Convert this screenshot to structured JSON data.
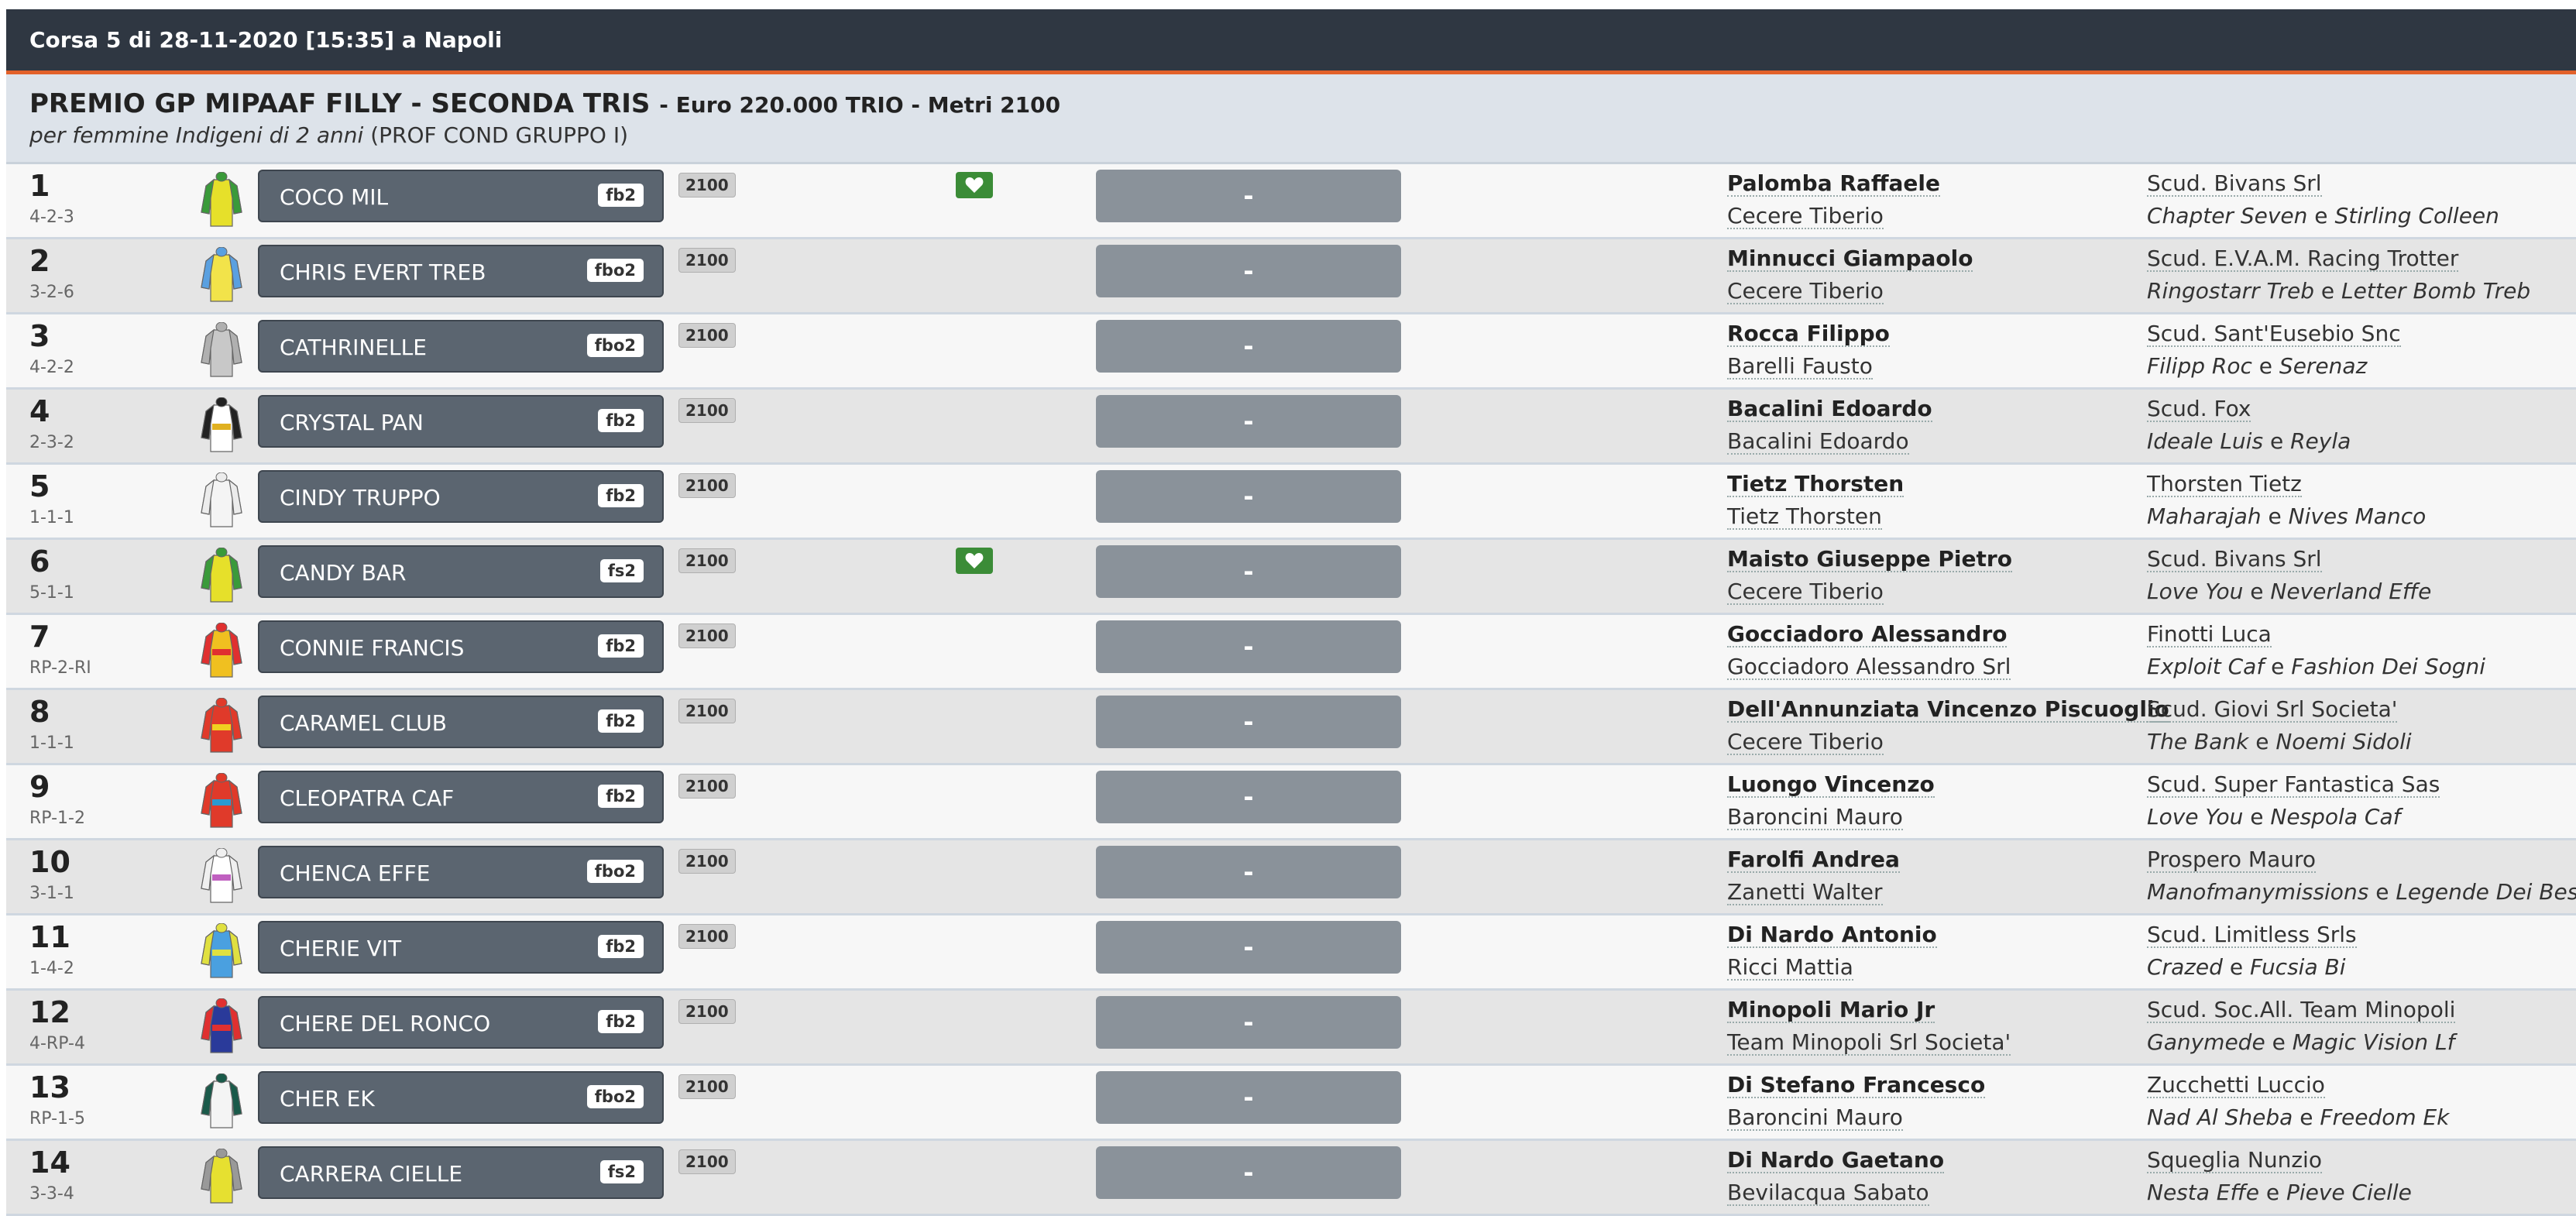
{
  "header": {
    "title": "Corsa 5 di 28-11-2020 [15:35] a Napoli"
  },
  "race": {
    "name": "PREMIO GP MIPAAF FILLY - SECONDA TRIS",
    "details": "- Euro 220.000 TRIO - Metri 2100",
    "category": "per femmine Indigeni di 2 anni",
    "conditions": "(PROF COND GRUPPO I)"
  },
  "colors": {
    "accent": "#e2612a",
    "header_bg": "#2f3742",
    "horse_bg": "#5b6570",
    "favorite": "#3b8c37"
  },
  "runners": [
    {
      "num": "1",
      "form": "4-2-3",
      "jersey": {
        "body": "#e6e02a",
        "sleeve": "#3a9a3a",
        "stripe": ""
      },
      "horse": "COCO MIL",
      "tag": "fb2",
      "dist": "2100",
      "favorite": true,
      "score": "-",
      "driver": "Palomba Raffaele",
      "trainer": "Cecere Tiberio",
      "owner": "Scud. Bivans Srl",
      "sire": "Chapter Seven",
      "conj": "e",
      "dam": "Stirling Colleen"
    },
    {
      "num": "2",
      "form": "3-2-6",
      "jersey": {
        "body": "#f2e34a",
        "sleeve": "#5aa0e0",
        "stripe": ""
      },
      "horse": "CHRIS EVERT TREB",
      "tag": "fbo2",
      "dist": "2100",
      "favorite": false,
      "score": "-",
      "driver": "Minnucci Giampaolo",
      "trainer": "Cecere Tiberio",
      "owner": "Scud. E.V.A.M. Racing Trotter",
      "sire": "Ringostarr Treb",
      "conj": "e",
      "dam": "Letter Bomb Treb"
    },
    {
      "num": "3",
      "form": "4-2-2",
      "jersey": {
        "body": "#c8c8c8",
        "sleeve": "#b0b0b0",
        "stripe": ""
      },
      "horse": "CATHRINELLE",
      "tag": "fbo2",
      "dist": "2100",
      "favorite": false,
      "score": "-",
      "driver": "Rocca Filippo",
      "trainer": "Barelli Fausto",
      "owner": "Scud. Sant'Eusebio Snc",
      "sire": "Filipp Roc",
      "conj": "e",
      "dam": "Serenaz"
    },
    {
      "num": "4",
      "form": "2-3-2",
      "jersey": {
        "body": "#ffffff",
        "sleeve": "#222222",
        "stripe": "#e0b020"
      },
      "horse": "CRYSTAL PAN",
      "tag": "fb2",
      "dist": "2100",
      "favorite": false,
      "score": "-",
      "driver": "Bacalini Edoardo",
      "trainer": "Bacalini Edoardo",
      "owner": "Scud. Fox",
      "sire": "Ideale Luis",
      "conj": "e",
      "dam": "Reyla"
    },
    {
      "num": "5",
      "form": "1-1-1",
      "jersey": {
        "body": "#f4f4f4",
        "sleeve": "#ececec",
        "stripe": ""
      },
      "horse": "CINDY TRUPPO",
      "tag": "fb2",
      "dist": "2100",
      "favorite": false,
      "score": "-",
      "driver": "Tietz Thorsten",
      "trainer": "Tietz Thorsten",
      "owner": "Thorsten Tietz",
      "sire": "Maharajah",
      "conj": "e",
      "dam": "Nives Manco"
    },
    {
      "num": "6",
      "form": "5-1-1",
      "jersey": {
        "body": "#e6e02a",
        "sleeve": "#3a9a3a",
        "stripe": ""
      },
      "horse": "CANDY BAR",
      "tag": "fs2",
      "dist": "2100",
      "favorite": true,
      "score": "-",
      "driver": "Maisto Giuseppe Pietro",
      "trainer": "Cecere Tiberio",
      "owner": "Scud. Bivans Srl",
      "sire": "Love You",
      "conj": "e",
      "dam": "Neverland Effe"
    },
    {
      "num": "7",
      "form": "RP-2-RI",
      "jersey": {
        "body": "#f0c020",
        "sleeve": "#e03030",
        "stripe": "#e03030"
      },
      "horse": "CONNIE FRANCIS",
      "tag": "fb2",
      "dist": "2100",
      "favorite": false,
      "score": "-",
      "driver": "Gocciadoro Alessandro",
      "trainer": "Gocciadoro Alessandro Srl",
      "owner": "Finotti Luca",
      "sire": "Exploit Caf",
      "conj": "e",
      "dam": "Fashion Dei Sogni"
    },
    {
      "num": "8",
      "form": "1-1-1",
      "jersey": {
        "body": "#e03a2a",
        "sleeve": "#e03a2a",
        "stripe": "#f0d020"
      },
      "horse": "CARAMEL CLUB",
      "tag": "fb2",
      "dist": "2100",
      "favorite": false,
      "score": "-",
      "driver": "Dell'Annunziata Vincenzo Piscuoglio",
      "trainer": "Cecere Tiberio",
      "owner": "Scud. Giovi Srl Societa'",
      "sire": "The Bank",
      "conj": "e",
      "dam": "Noemi Sidoli"
    },
    {
      "num": "9",
      "form": "RP-1-2",
      "jersey": {
        "body": "#e03a2a",
        "sleeve": "#e03a2a",
        "stripe": "#2a9ad0"
      },
      "horse": "CLEOPATRA CAF",
      "tag": "fb2",
      "dist": "2100",
      "favorite": false,
      "score": "-",
      "driver": "Luongo Vincenzo",
      "trainer": "Baroncini Mauro",
      "owner": "Scud. Super Fantastica Sas",
      "sire": "Love You",
      "conj": "e",
      "dam": "Nespola Caf"
    },
    {
      "num": "10",
      "form": "3-1-1",
      "jersey": {
        "body": "#ffffff",
        "sleeve": "#f0f0f0",
        "stripe": "#c060c0"
      },
      "horse": "CHENCA EFFE",
      "tag": "fbo2",
      "dist": "2100",
      "favorite": false,
      "score": "-",
      "driver": "Farolfi Andrea",
      "trainer": "Zanetti Walter",
      "owner": "Prospero Mauro",
      "sire": "Manofmanymissions",
      "conj": "e",
      "dam": "Legende Dei Bessi"
    },
    {
      "num": "11",
      "form": "1-4-2",
      "jersey": {
        "body": "#4aa0e0",
        "sleeve": "#e0e040",
        "stripe": "#e0e040"
      },
      "horse": "CHERIE VIT",
      "tag": "fb2",
      "dist": "2100",
      "favorite": false,
      "score": "-",
      "driver": "Di Nardo Antonio",
      "trainer": "Ricci Mattia",
      "owner": "Scud. Limitless Srls",
      "sire": "Crazed",
      "conj": "e",
      "dam": "Fucsia Bi"
    },
    {
      "num": "12",
      "form": "4-RP-4",
      "jersey": {
        "body": "#2a3a9a",
        "sleeve": "#e03030",
        "stripe": "#e03030"
      },
      "horse": "CHERE DEL RONCO",
      "tag": "fb2",
      "dist": "2100",
      "favorite": false,
      "score": "-",
      "driver": "Minopoli Mario Jr",
      "trainer": "Team Minopoli Srl Societa'",
      "owner": "Scud. Soc.All. Team Minopoli",
      "sire": "Ganymede",
      "conj": "e",
      "dam": "Magic Vision Lf"
    },
    {
      "num": "13",
      "form": "RP-1-5",
      "jersey": {
        "body": "#f4f4f4",
        "sleeve": "#1a5a4a",
        "stripe": ""
      },
      "horse": "CHER EK",
      "tag": "fbo2",
      "dist": "2100",
      "favorite": false,
      "score": "-",
      "driver": "Di Stefano Francesco",
      "trainer": "Baroncini Mauro",
      "owner": "Zucchetti Luccio",
      "sire": "Nad Al Sheba",
      "conj": "e",
      "dam": "Freedom Ek"
    },
    {
      "num": "14",
      "form": "3-3-4",
      "jersey": {
        "body": "#e6e030",
        "sleeve": "#999999",
        "stripe": ""
      },
      "horse": "CARRERA CIELLE",
      "tag": "fs2",
      "dist": "2100",
      "favorite": false,
      "score": "-",
      "driver": "Di Nardo Gaetano",
      "trainer": "Bevilacqua Sabato",
      "owner": "Squeglia Nunzio",
      "sire": "Nesta Effe",
      "conj": "e",
      "dam": "Pieve Cielle"
    }
  ]
}
